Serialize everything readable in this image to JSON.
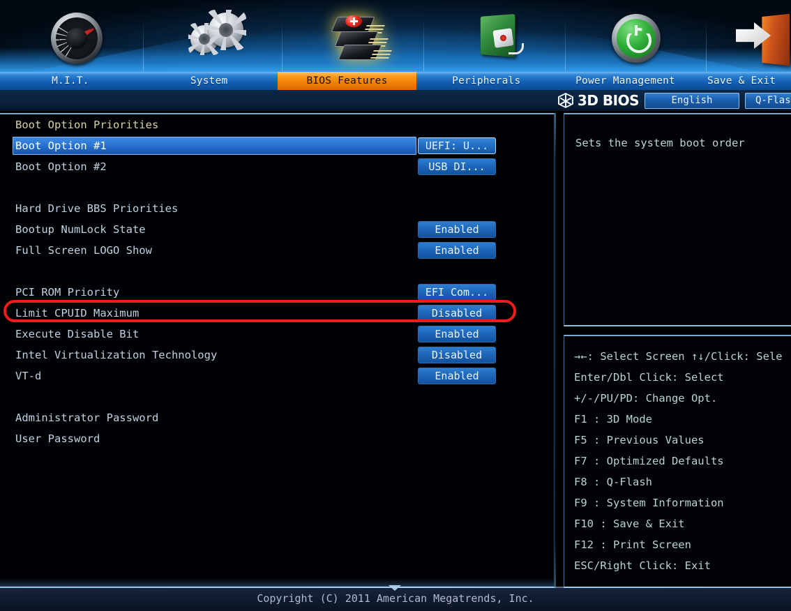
{
  "header": {
    "tabs": [
      {
        "label": "M.I.T.",
        "icon": "speedometer-icon",
        "active": false
      },
      {
        "label": "System",
        "icon": "gears-icon",
        "active": false
      },
      {
        "label": "BIOS Features",
        "icon": "chip-stack-icon",
        "active": true
      },
      {
        "label": "Peripherals",
        "icon": "socket-plug-icon",
        "active": false
      },
      {
        "label": "Power Management",
        "icon": "power-button-icon",
        "active": false
      },
      {
        "label": "Save & Exit",
        "icon": "exit-door-icon",
        "active": false
      }
    ]
  },
  "biosbar": {
    "brand": "3D BIOS",
    "logo_icon": "hex-cube-icon",
    "language_label": "English",
    "qflash_label": "Q-Flash"
  },
  "settings": [
    {
      "label": "Boot Option Priorities",
      "type": "heading",
      "value": null,
      "selected": false
    },
    {
      "label": "Boot Option #1",
      "type": "item",
      "value": "UEFI: U...",
      "selected": true,
      "value_focus": true
    },
    {
      "label": "Boot Option #2",
      "type": "item",
      "value": "USB DI...",
      "selected": false
    },
    {
      "label": "",
      "type": "spacer",
      "value": null,
      "selected": false
    },
    {
      "label": "Hard Drive BBS Priorities",
      "type": "item",
      "value": null,
      "selected": false
    },
    {
      "label": "Bootup NumLock State",
      "type": "item",
      "value": "Enabled",
      "selected": false
    },
    {
      "label": "Full Screen LOGO Show",
      "type": "item",
      "value": "Enabled",
      "selected": false
    },
    {
      "label": "",
      "type": "spacer",
      "value": null,
      "selected": false
    },
    {
      "label": "PCI ROM Priority",
      "type": "item",
      "value": "EFI Com...",
      "selected": false,
      "annotated": true
    },
    {
      "label": "Limit CPUID Maximum",
      "type": "item",
      "value": "Disabled",
      "selected": false
    },
    {
      "label": "Execute Disable Bit",
      "type": "item",
      "value": "Enabled",
      "selected": false
    },
    {
      "label": "Intel Virtualization Technology",
      "type": "item",
      "value": "Disabled",
      "selected": false
    },
    {
      "label": "VT-d",
      "type": "item",
      "value": "Enabled",
      "selected": false
    },
    {
      "label": "",
      "type": "spacer",
      "value": null,
      "selected": false
    },
    {
      "label": "Administrator Password",
      "type": "item",
      "value": null,
      "selected": false
    },
    {
      "label": "User Password",
      "type": "item",
      "value": null,
      "selected": false
    }
  ],
  "help": {
    "text": "Sets the system boot order"
  },
  "keylegend": [
    "→←: Select Screen  ↑↓/Click: Sele",
    "Enter/Dbl Click: Select",
    "+/-/PU/PD: Change Opt.",
    "F1  : 3D Mode",
    "F5  : Previous Values",
    "F7  : Optimized Defaults",
    "F8  : Q-Flash",
    "F9  : System Information",
    "F10 : Save & Exit",
    "F12 : Print Screen",
    "ESC/Right Click: Exit"
  ],
  "footer": {
    "copyright": "Copyright (C) 2011 American Megatrends, Inc."
  },
  "colors": {
    "accent_orange": "#ef7c05",
    "highlight_blue": "#2f7ad6",
    "annotation_red": "#ee1c1c",
    "heading_yellow": "#d8d2a6",
    "label_blue": "#bed3e0",
    "help_green": "#b9d7cf"
  }
}
